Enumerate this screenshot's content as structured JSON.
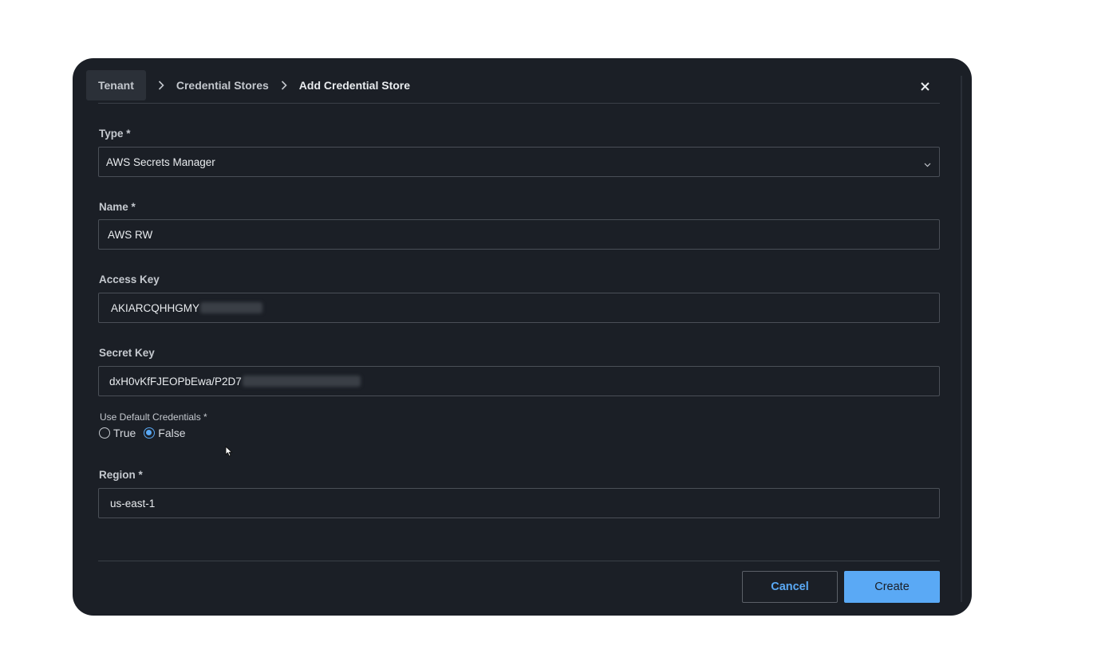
{
  "breadcrumb": {
    "items": [
      "Tenant",
      "Credential Stores",
      "Add Credential Store"
    ]
  },
  "fields": {
    "type": {
      "label": "Type *",
      "value": "AWS Secrets Manager"
    },
    "name": {
      "label": "Name *",
      "value": "AWS RW"
    },
    "access_key": {
      "label": "Access Key",
      "value": "AKIARCQHHGMY"
    },
    "secret_key": {
      "label": "Secret Key",
      "value": "dxH0vKfFJEOPbEwa/P2D7"
    },
    "use_default": {
      "label": "Use Default Credentials *",
      "options": [
        "True",
        "False"
      ],
      "selected": "False"
    },
    "region": {
      "label": "Region *",
      "value": "us-east-1"
    }
  },
  "footer": {
    "cancel_label": "Cancel",
    "create_label": "Create"
  },
  "colors": {
    "accent": "#5aa9f5",
    "modal_bg": "#1b1f26"
  }
}
